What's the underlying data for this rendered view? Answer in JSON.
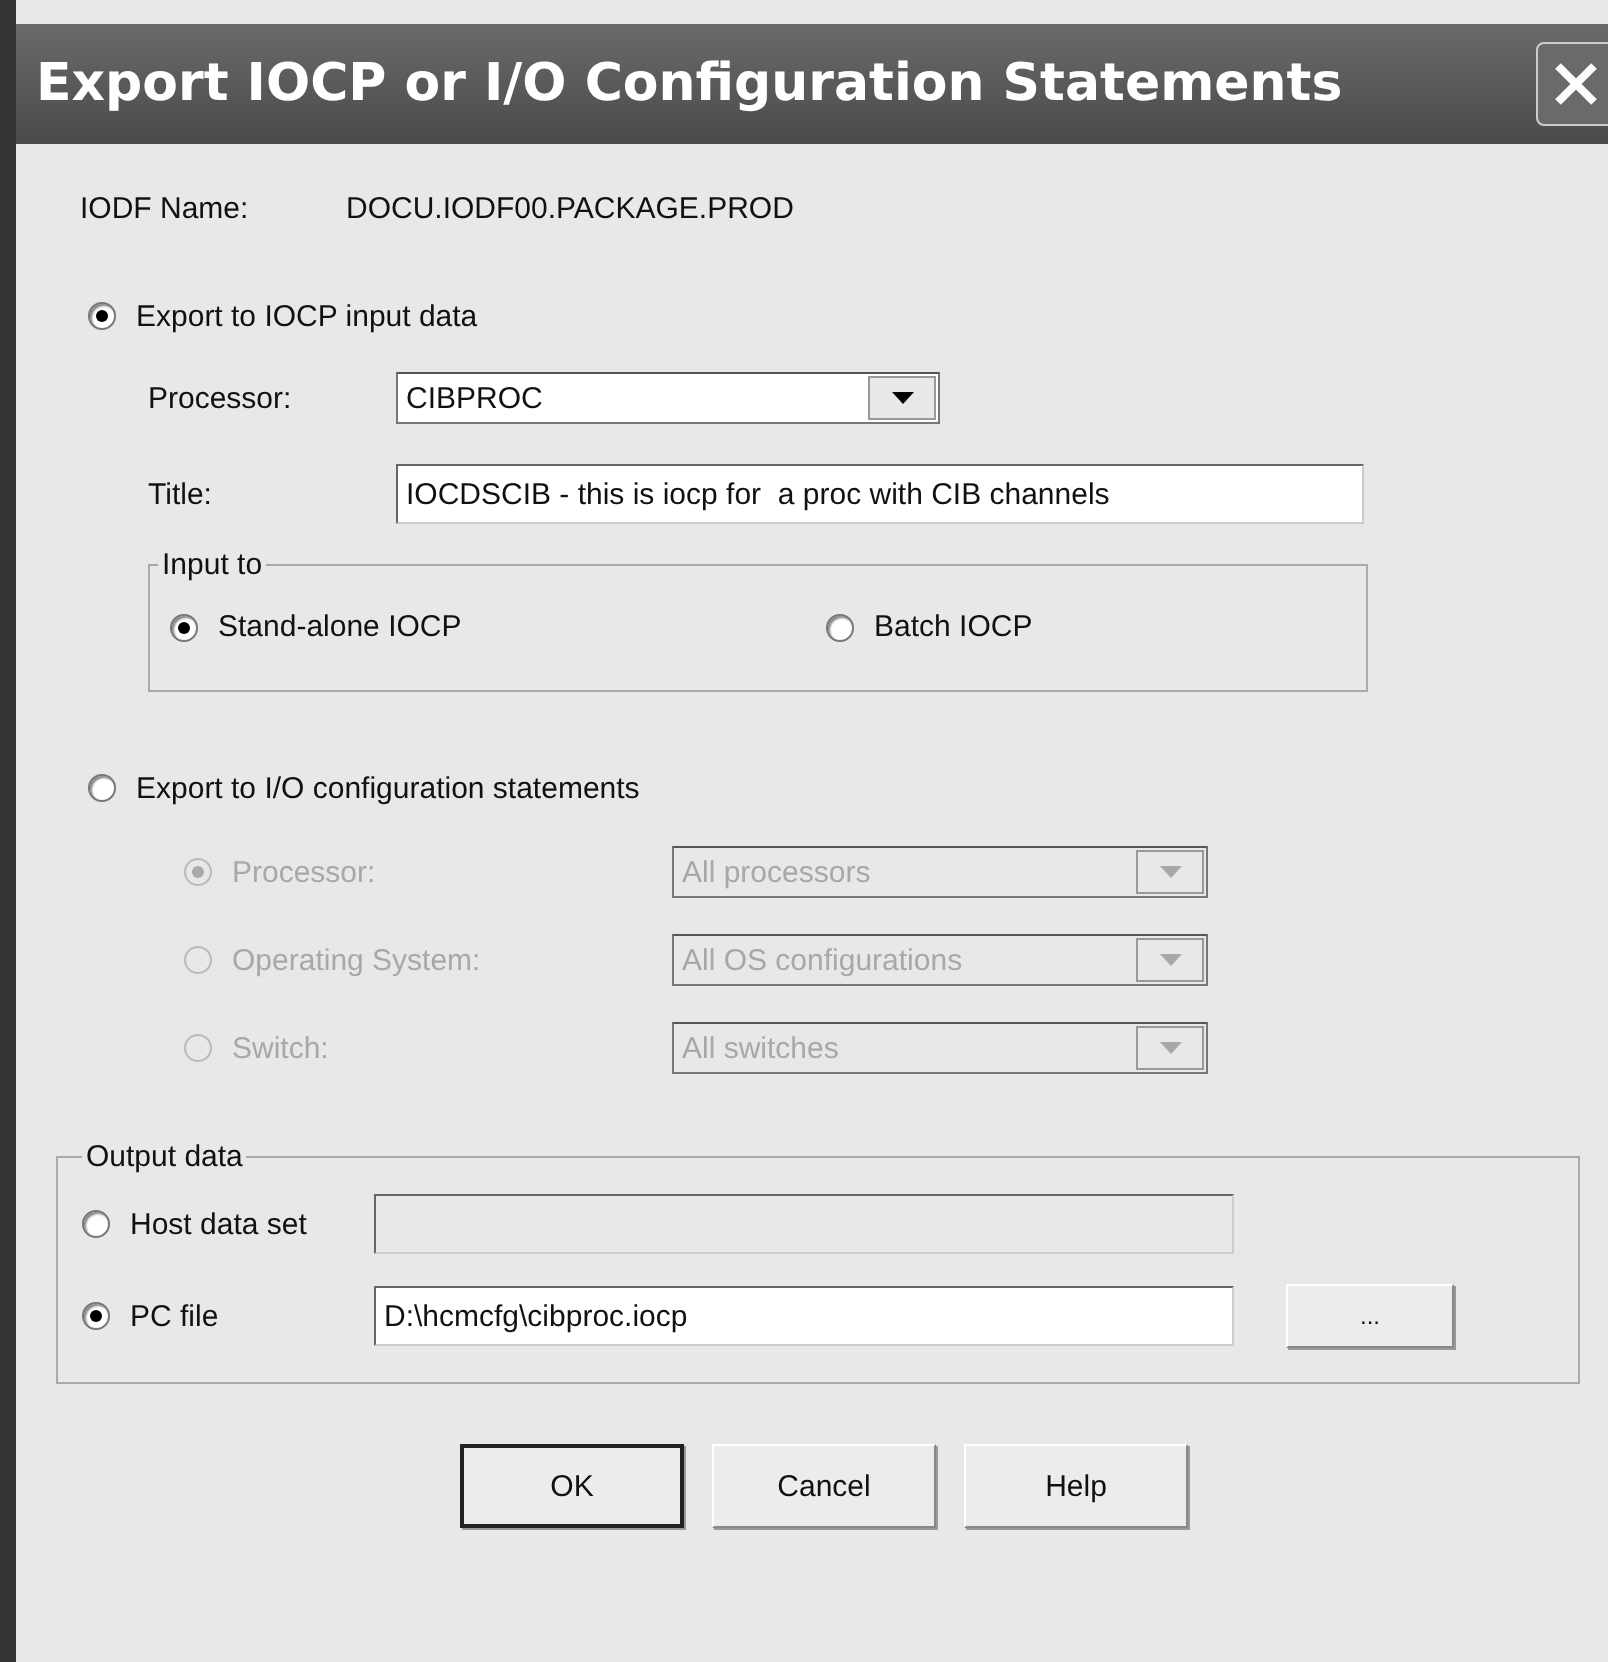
{
  "window": {
    "title": "Export IOCP or I/O Configuration Statements"
  },
  "iodf": {
    "label": "IODF Name:",
    "value": "DOCU.IODF00.PACKAGE.PROD"
  },
  "iocp_option": {
    "label": "Export to IOCP input data",
    "selected": true,
    "processor": {
      "label": "Processor:",
      "value": "CIBPROC"
    },
    "title": {
      "label": "Title:",
      "value": "IOCDSCIB - this is iocp for  a proc with CIB channels"
    },
    "input_to": {
      "legend": "Input to",
      "options": [
        {
          "label": "Stand-alone IOCP",
          "selected": true
        },
        {
          "label": "Batch IOCP",
          "selected": false
        }
      ]
    }
  },
  "config_option": {
    "label": "Export to I/O configuration statements",
    "selected": false,
    "disabled": true,
    "choices": [
      {
        "label": "Processor:",
        "selected": true,
        "value": "All processors"
      },
      {
        "label": "Operating System:",
        "selected": false,
        "value": "All OS configurations"
      },
      {
        "label": "Switch:",
        "selected": false,
        "value": "All switches"
      }
    ]
  },
  "output_data": {
    "legend": "Output data",
    "options": [
      {
        "label": "Host data set",
        "selected": false
      },
      {
        "label": "PC file",
        "selected": true,
        "value": "D:\\hcmcfg\\cibproc.iocp"
      }
    ],
    "browse_button": "..."
  },
  "buttons": [
    {
      "label": "OK",
      "default": true
    },
    {
      "label": "Cancel",
      "default": false
    },
    {
      "label": "Help",
      "default": false
    }
  ]
}
